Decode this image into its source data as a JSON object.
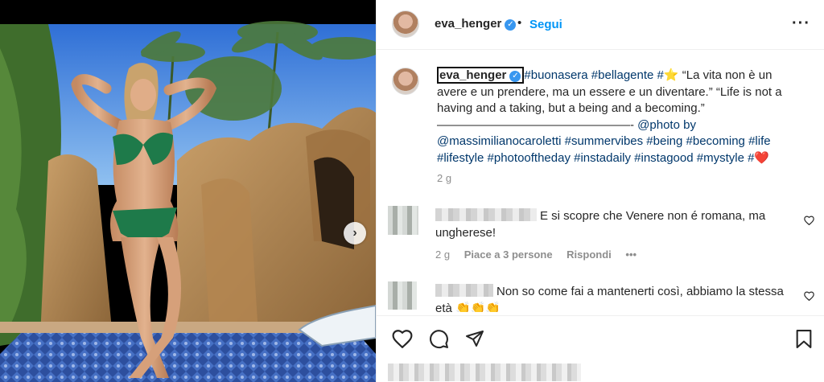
{
  "post": {
    "username": "eva_henger",
    "follow_label": "Segui",
    "separator": "•",
    "more_icon": "···",
    "caption_text_1": " ",
    "caption_tags_1": "#buonasera #bellagente #",
    "caption_quote": " “La vita non è un avere e un prendere, ma un essere e un diventare.” “Life is not a having and a taking, but a being and a becoming.” ————————————————- ",
    "caption_tags_2": "@photo by @massimilianocaroletti #summervibes #being #becoming #life #lifestyle #photooftheday #instadaily #instagood #mystyle #",
    "caption_age": "2 g",
    "star_emoji": "⭐",
    "heart_emoji": "❤️"
  },
  "comments": [
    {
      "text": "E si scopre che Venere non é romana, ma ungherese!",
      "age": "2 g",
      "likes": "Piace a 3 persone",
      "reply": "Rispondi",
      "more": "•••"
    },
    {
      "text": "Non so come fai a mantenerti così, abbiamo la stessa età ",
      "emojis": "👏👏👏"
    }
  ],
  "icons": {
    "verified": "✓",
    "next": "›"
  },
  "colors": {
    "link": "#00376b",
    "follow": "#0095f6",
    "verified": "#3897f0",
    "muted": "#8e8e8e"
  }
}
